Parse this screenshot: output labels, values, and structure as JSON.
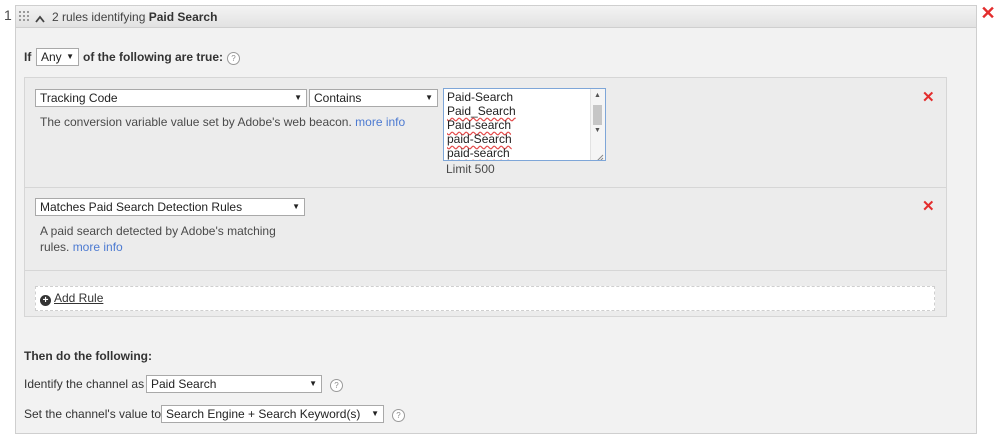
{
  "row_number": "1",
  "header": {
    "prefix": "2 rules identifying",
    "name": "Paid Search"
  },
  "condition": {
    "if_label": "If",
    "match_value": "Any",
    "suffix": "of the following are true:"
  },
  "rules": [
    {
      "field": "Tracking Code",
      "operator": "Contains",
      "values": [
        "Paid-Search",
        "Paid_Search",
        "Paid-search",
        "paid-Search",
        "paid-search"
      ],
      "limit_text": "Limit 500",
      "description": "The conversion variable value set by Adobe's web beacon.",
      "more_info": "more info"
    },
    {
      "field": "Matches Paid Search Detection Rules",
      "description_line1": "A paid search detected by Adobe's matching",
      "description_line2": "rules.",
      "more_info": "more info"
    }
  ],
  "add_rule_label": "Add Rule",
  "then": {
    "title": "Then do the following:",
    "identify_label": "Identify the channel as",
    "identify_value": "Paid Search",
    "set_label": "Set the channel's value to",
    "set_value": "Search Engine + Search Keyword(s)"
  },
  "icons": {
    "delete": "close-icon",
    "help": "question-icon",
    "drag": "grip-icon",
    "collapse": "chevron-up-icon",
    "add": "plus-circle-icon"
  },
  "colors": {
    "delete_red": "#e32d2d",
    "link_blue": "#4c7ad1",
    "panel_bg": "#f2f2f2"
  }
}
